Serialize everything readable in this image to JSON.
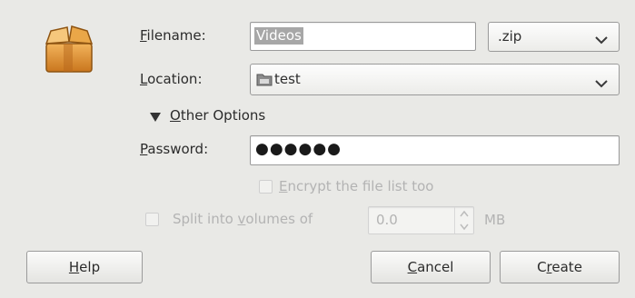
{
  "dialog": {
    "filename_label_prefix": "F",
    "filename_label_rest": "ilename:",
    "filename_value": "Videos",
    "extension_value": ".zip",
    "location_label_prefix": "L",
    "location_label_rest": "ocation:",
    "location_value": "test",
    "other_options_prefix": "O",
    "other_options_rest": "ther Options",
    "password_label_prefix": "P",
    "password_label_rest": "assword:",
    "password_mask": "●●●●●●",
    "encrypt_prefix": "E",
    "encrypt_rest": "ncrypt the file list too",
    "split_text_a": "Split into ",
    "split_underline": "v",
    "split_text_b": "olumes of",
    "volume_value": "0.0",
    "volume_unit": "MB"
  },
  "buttons": {
    "help_prefix": "H",
    "help_rest": "elp",
    "cancel_prefix": "C",
    "cancel_rest": "ancel",
    "create_a": "C",
    "create_u": "r",
    "create_b": "eate"
  },
  "icons": {
    "archive": "archive-package-icon",
    "folder": "folder-icon",
    "expander": "triangle-down-icon",
    "dropdown": "chevron-down-icon"
  }
}
